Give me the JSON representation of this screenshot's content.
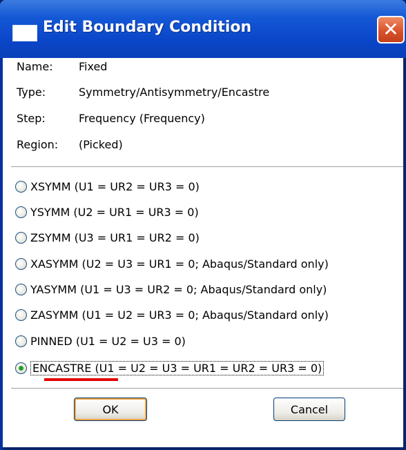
{
  "dialog": {
    "title": "Edit Boundary Condition",
    "close_glyph": "✕"
  },
  "info": {
    "name_label": "Name:",
    "name_value": "Fixed",
    "type_label": "Type:",
    "type_value": "Symmetry/Antisymmetry/Encastre",
    "step_label": "Step:",
    "step_value": "Frequency (Frequency)",
    "region_label": "Region:",
    "region_value": "(Picked)"
  },
  "options": [
    {
      "label": "XSYMM (U1 = UR2 = UR3 = 0)",
      "selected": false
    },
    {
      "label": "YSYMM (U2 = UR1 = UR3 = 0)",
      "selected": false
    },
    {
      "label": "ZSYMM (U3 = UR1 = UR2 = 0)",
      "selected": false
    },
    {
      "label": "XASYMM (U2 = U3 = UR1 = 0; Abaqus/Standard only)",
      "selected": false
    },
    {
      "label": "YASYMM (U1 = U3 = UR2 = 0; Abaqus/Standard only)",
      "selected": false
    },
    {
      "label": "ZASYMM (U1 = U2 = UR3 = 0; Abaqus/Standard only)",
      "selected": false
    },
    {
      "label": "PINNED (U1 = U2 = U3 = 0)",
      "selected": false
    },
    {
      "label": "ENCASTRE (U1 = U2 = U3 = UR1 = UR2 = UR3 = 0)",
      "selected": true
    }
  ],
  "buttons": {
    "ok_label": "OK",
    "cancel_label": "Cancel"
  },
  "colors": {
    "titlebar": "#0a46c8",
    "close_button": "#d9532c",
    "radio_dot": "#21a121",
    "annotation_underline": "#e00000"
  }
}
